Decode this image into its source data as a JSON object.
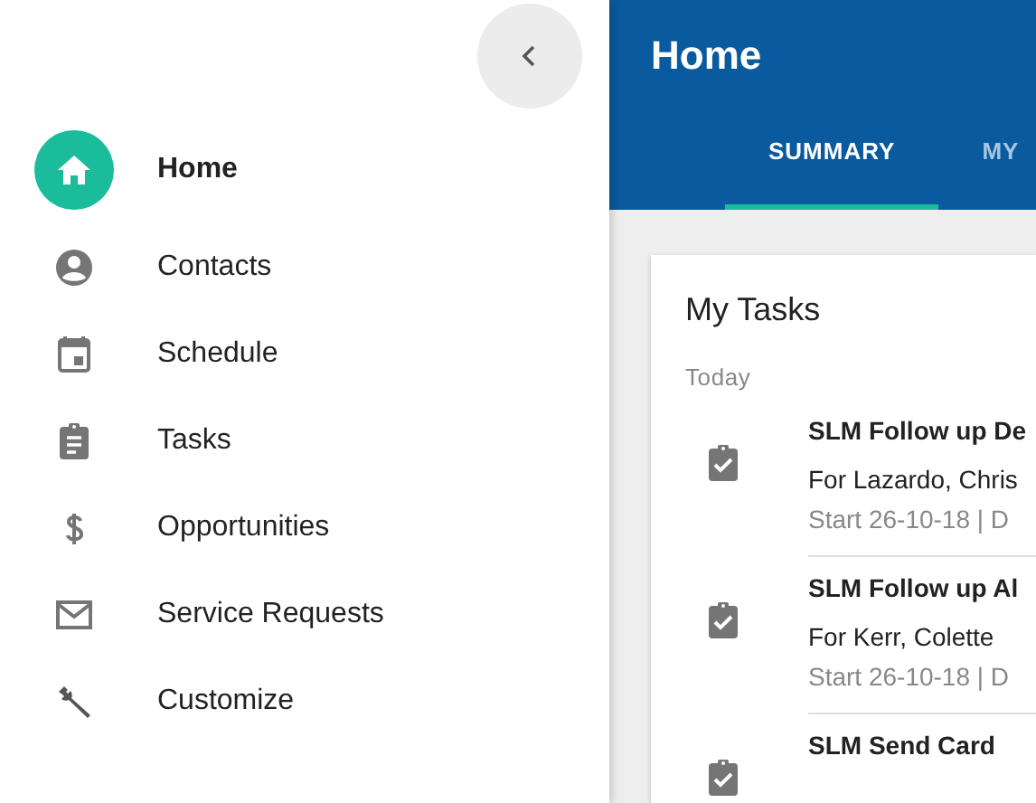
{
  "sidebar": {
    "items": [
      {
        "label": "Home",
        "selected": true
      },
      {
        "label": "Contacts",
        "selected": false
      },
      {
        "label": "Schedule",
        "selected": false
      },
      {
        "label": "Tasks",
        "selected": false
      },
      {
        "label": "Opportunities",
        "selected": false
      },
      {
        "label": "Service Requests",
        "selected": false
      },
      {
        "label": "Customize",
        "selected": false
      }
    ]
  },
  "header": {
    "title": "Home",
    "tabs": [
      {
        "label": "SUMMARY",
        "selected": true
      },
      {
        "label": "MY",
        "selected": false
      }
    ]
  },
  "card": {
    "title": "My Tasks",
    "section": "Today",
    "tasks": [
      {
        "title": "SLM Follow up De",
        "for": "For Lazardo, Chris",
        "meta": "Start 26-10-18 | D"
      },
      {
        "title": "SLM Follow up Al",
        "for": "For Kerr, Colette",
        "meta": "Start 26-10-18 | D"
      },
      {
        "title": "SLM Send Card"
      }
    ]
  }
}
